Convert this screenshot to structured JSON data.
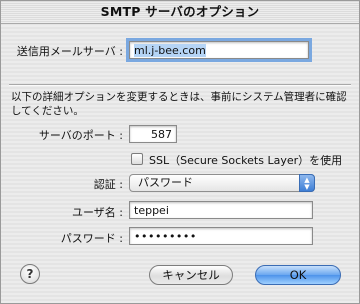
{
  "window": {
    "title": "SMTP サーバのオプション"
  },
  "outgoing_server": {
    "label": "送信用メールサーバ :",
    "value": "ml.j-bee.com"
  },
  "description": "以下の詳細オプションを変更するときは、事前にシステム管理者に確認してください。",
  "server_port": {
    "label": "サーバのポート :",
    "value": "587"
  },
  "ssl": {
    "label": "SSL（Secure Sockets Layer）を使用",
    "checked": false
  },
  "authentication": {
    "label": "認証 :",
    "selected": "パスワード"
  },
  "username": {
    "label": "ユーザ名 :",
    "value": "teppei"
  },
  "password": {
    "label": "パスワード :",
    "value": "•••••••••"
  },
  "buttons": {
    "help": "?",
    "cancel": "キャンセル",
    "ok": "OK"
  },
  "colors": {
    "focus_ring": "#7aa8e0",
    "default_button": "#4d93ea"
  }
}
